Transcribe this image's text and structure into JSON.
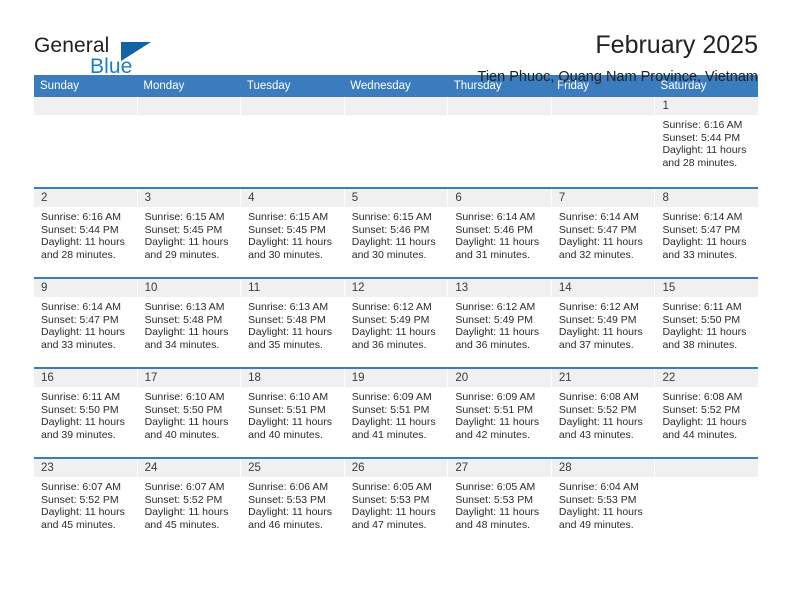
{
  "brand": {
    "word_one": "General",
    "word_two": "Blue",
    "accent_color": "#1263a5",
    "text_color": "#231f20"
  },
  "header": {
    "title": "February 2025",
    "subtitle": "Tien Phuoc, Quang Nam Province, Vietnam"
  },
  "calendar": {
    "header_color": "#3a7cbe",
    "daynum_band_color": "#f0f0f0",
    "weekdays": [
      "Sunday",
      "Monday",
      "Tuesday",
      "Wednesday",
      "Thursday",
      "Friday",
      "Saturday"
    ],
    "weeks": [
      [
        {
          "day": "",
          "sunrise": "",
          "sunset": "",
          "daylight": "",
          "blank": true
        },
        {
          "day": "",
          "sunrise": "",
          "sunset": "",
          "daylight": "",
          "blank": true
        },
        {
          "day": "",
          "sunrise": "",
          "sunset": "",
          "daylight": "",
          "blank": true
        },
        {
          "day": "",
          "sunrise": "",
          "sunset": "",
          "daylight": "",
          "blank": true
        },
        {
          "day": "",
          "sunrise": "",
          "sunset": "",
          "daylight": "",
          "blank": true
        },
        {
          "day": "",
          "sunrise": "",
          "sunset": "",
          "daylight": "",
          "blank": true
        },
        {
          "day": "1",
          "sunrise": "Sunrise: 6:16 AM",
          "sunset": "Sunset: 5:44 PM",
          "daylight": "Daylight: 11 hours and 28 minutes.",
          "blank": false
        }
      ],
      [
        {
          "day": "2",
          "sunrise": "Sunrise: 6:16 AM",
          "sunset": "Sunset: 5:44 PM",
          "daylight": "Daylight: 11 hours and 28 minutes.",
          "blank": false
        },
        {
          "day": "3",
          "sunrise": "Sunrise: 6:15 AM",
          "sunset": "Sunset: 5:45 PM",
          "daylight": "Daylight: 11 hours and 29 minutes.",
          "blank": false
        },
        {
          "day": "4",
          "sunrise": "Sunrise: 6:15 AM",
          "sunset": "Sunset: 5:45 PM",
          "daylight": "Daylight: 11 hours and 30 minutes.",
          "blank": false
        },
        {
          "day": "5",
          "sunrise": "Sunrise: 6:15 AM",
          "sunset": "Sunset: 5:46 PM",
          "daylight": "Daylight: 11 hours and 30 minutes.",
          "blank": false
        },
        {
          "day": "6",
          "sunrise": "Sunrise: 6:14 AM",
          "sunset": "Sunset: 5:46 PM",
          "daylight": "Daylight: 11 hours and 31 minutes.",
          "blank": false
        },
        {
          "day": "7",
          "sunrise": "Sunrise: 6:14 AM",
          "sunset": "Sunset: 5:47 PM",
          "daylight": "Daylight: 11 hours and 32 minutes.",
          "blank": false
        },
        {
          "day": "8",
          "sunrise": "Sunrise: 6:14 AM",
          "sunset": "Sunset: 5:47 PM",
          "daylight": "Daylight: 11 hours and 33 minutes.",
          "blank": false
        }
      ],
      [
        {
          "day": "9",
          "sunrise": "Sunrise: 6:14 AM",
          "sunset": "Sunset: 5:47 PM",
          "daylight": "Daylight: 11 hours and 33 minutes.",
          "blank": false
        },
        {
          "day": "10",
          "sunrise": "Sunrise: 6:13 AM",
          "sunset": "Sunset: 5:48 PM",
          "daylight": "Daylight: 11 hours and 34 minutes.",
          "blank": false
        },
        {
          "day": "11",
          "sunrise": "Sunrise: 6:13 AM",
          "sunset": "Sunset: 5:48 PM",
          "daylight": "Daylight: 11 hours and 35 minutes.",
          "blank": false
        },
        {
          "day": "12",
          "sunrise": "Sunrise: 6:12 AM",
          "sunset": "Sunset: 5:49 PM",
          "daylight": "Daylight: 11 hours and 36 minutes.",
          "blank": false
        },
        {
          "day": "13",
          "sunrise": "Sunrise: 6:12 AM",
          "sunset": "Sunset: 5:49 PM",
          "daylight": "Daylight: 11 hours and 36 minutes.",
          "blank": false
        },
        {
          "day": "14",
          "sunrise": "Sunrise: 6:12 AM",
          "sunset": "Sunset: 5:49 PM",
          "daylight": "Daylight: 11 hours and 37 minutes.",
          "blank": false
        },
        {
          "day": "15",
          "sunrise": "Sunrise: 6:11 AM",
          "sunset": "Sunset: 5:50 PM",
          "daylight": "Daylight: 11 hours and 38 minutes.",
          "blank": false
        }
      ],
      [
        {
          "day": "16",
          "sunrise": "Sunrise: 6:11 AM",
          "sunset": "Sunset: 5:50 PM",
          "daylight": "Daylight: 11 hours and 39 minutes.",
          "blank": false
        },
        {
          "day": "17",
          "sunrise": "Sunrise: 6:10 AM",
          "sunset": "Sunset: 5:50 PM",
          "daylight": "Daylight: 11 hours and 40 minutes.",
          "blank": false
        },
        {
          "day": "18",
          "sunrise": "Sunrise: 6:10 AM",
          "sunset": "Sunset: 5:51 PM",
          "daylight": "Daylight: 11 hours and 40 minutes.",
          "blank": false
        },
        {
          "day": "19",
          "sunrise": "Sunrise: 6:09 AM",
          "sunset": "Sunset: 5:51 PM",
          "daylight": "Daylight: 11 hours and 41 minutes.",
          "blank": false
        },
        {
          "day": "20",
          "sunrise": "Sunrise: 6:09 AM",
          "sunset": "Sunset: 5:51 PM",
          "daylight": "Daylight: 11 hours and 42 minutes.",
          "blank": false
        },
        {
          "day": "21",
          "sunrise": "Sunrise: 6:08 AM",
          "sunset": "Sunset: 5:52 PM",
          "daylight": "Daylight: 11 hours and 43 minutes.",
          "blank": false
        },
        {
          "day": "22",
          "sunrise": "Sunrise: 6:08 AM",
          "sunset": "Sunset: 5:52 PM",
          "daylight": "Daylight: 11 hours and 44 minutes.",
          "blank": false
        }
      ],
      [
        {
          "day": "23",
          "sunrise": "Sunrise: 6:07 AM",
          "sunset": "Sunset: 5:52 PM",
          "daylight": "Daylight: 11 hours and 45 minutes.",
          "blank": false
        },
        {
          "day": "24",
          "sunrise": "Sunrise: 6:07 AM",
          "sunset": "Sunset: 5:52 PM",
          "daylight": "Daylight: 11 hours and 45 minutes.",
          "blank": false
        },
        {
          "day": "25",
          "sunrise": "Sunrise: 6:06 AM",
          "sunset": "Sunset: 5:53 PM",
          "daylight": "Daylight: 11 hours and 46 minutes.",
          "blank": false
        },
        {
          "day": "26",
          "sunrise": "Sunrise: 6:05 AM",
          "sunset": "Sunset: 5:53 PM",
          "daylight": "Daylight: 11 hours and 47 minutes.",
          "blank": false
        },
        {
          "day": "27",
          "sunrise": "Sunrise: 6:05 AM",
          "sunset": "Sunset: 5:53 PM",
          "daylight": "Daylight: 11 hours and 48 minutes.",
          "blank": false
        },
        {
          "day": "28",
          "sunrise": "Sunrise: 6:04 AM",
          "sunset": "Sunset: 5:53 PM",
          "daylight": "Daylight: 11 hours and 49 minutes.",
          "blank": false
        },
        {
          "day": "",
          "sunrise": "",
          "sunset": "",
          "daylight": "",
          "blank": true
        }
      ]
    ]
  }
}
